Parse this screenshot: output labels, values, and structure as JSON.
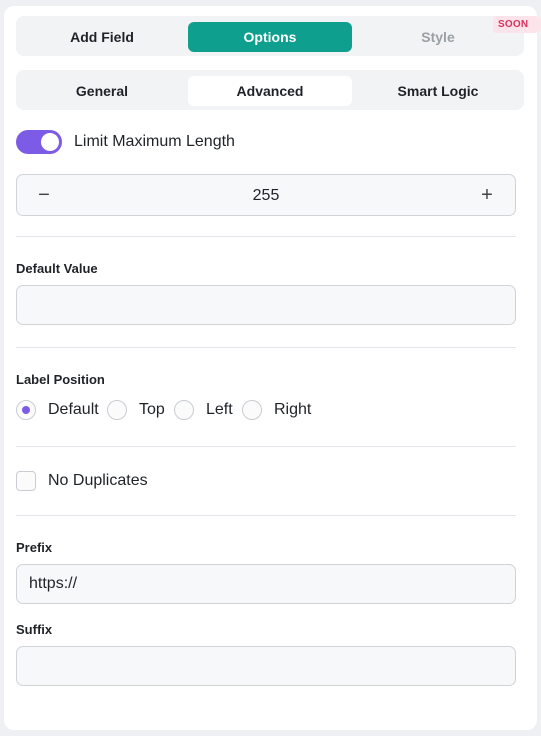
{
  "tabs": [
    {
      "label": "Add Field",
      "state": "inactive"
    },
    {
      "label": "Options",
      "state": "active"
    },
    {
      "label": "Style",
      "state": "disabled",
      "badge": "SOON"
    }
  ],
  "subtabs": [
    {
      "label": "General",
      "state": "inactive"
    },
    {
      "label": "Advanced",
      "state": "active"
    },
    {
      "label": "Smart Logic",
      "state": "inactive"
    }
  ],
  "max_length": {
    "toggle_label": "Limit Maximum Length",
    "enabled": true,
    "minus_symbol": "−",
    "plus_symbol": "+",
    "value": "255"
  },
  "default_value": {
    "label": "Default Value",
    "value": ""
  },
  "label_position": {
    "label": "Label Position",
    "options": [
      "Default",
      "Top",
      "Left",
      "Right"
    ],
    "selected": "Default"
  },
  "no_duplicates": {
    "label": "No Duplicates",
    "checked": false
  },
  "prefix": {
    "label": "Prefix",
    "value": "https://"
  },
  "suffix": {
    "label": "Suffix",
    "value": ""
  },
  "colors": {
    "primary_teal": "#0f9f8e",
    "accent_purple": "#7c5ce6",
    "badge_bg": "#fde4ea",
    "badge_text": "#d6335d"
  }
}
